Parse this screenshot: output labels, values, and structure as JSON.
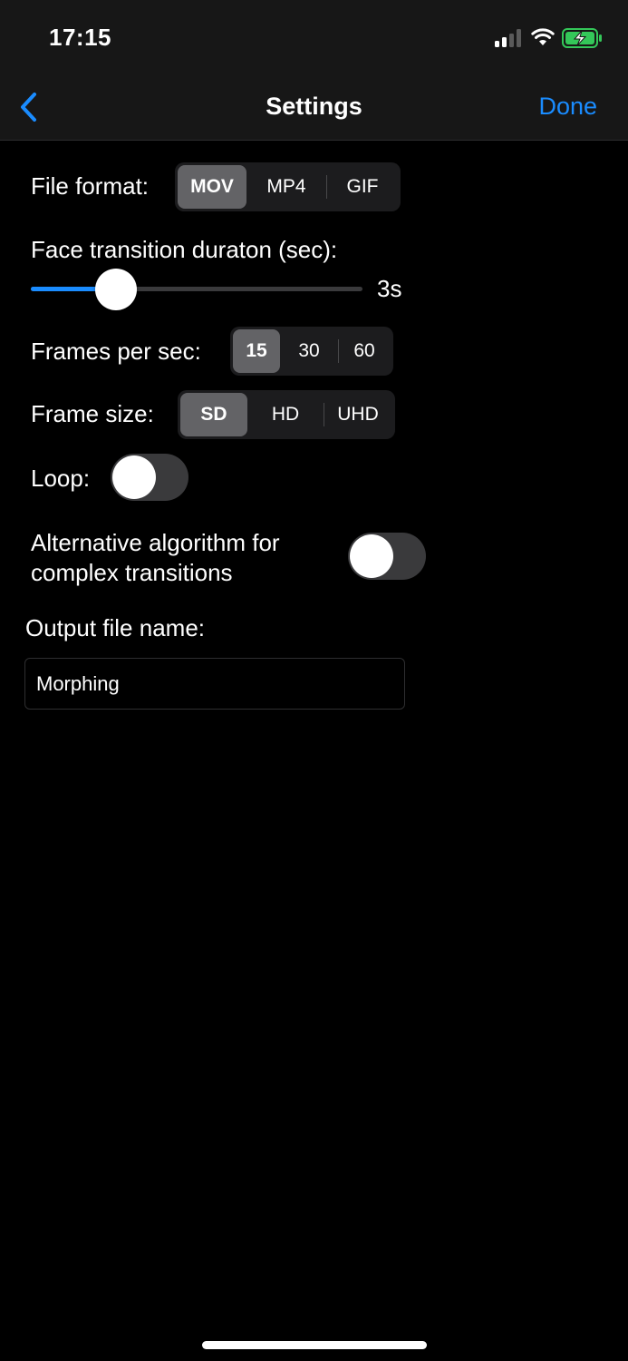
{
  "status_bar": {
    "time": "17:15",
    "battery_color": "#34c759"
  },
  "nav": {
    "back_icon": "chevron-left-icon",
    "title": "Settings",
    "done_label": "Done",
    "accent_color": "#1a8cff"
  },
  "settings": {
    "file_format": {
      "label": "File format:",
      "options": [
        "MOV",
        "MP4",
        "GIF"
      ],
      "selected": "MOV"
    },
    "face_transition": {
      "label": "Face transition duraton (sec):",
      "value_label": "3s",
      "fill_fraction": 0.25
    },
    "frames_per_sec": {
      "label": "Frames per sec:",
      "options": [
        "15",
        "30",
        "60"
      ],
      "selected": "15"
    },
    "frame_size": {
      "label": "Frame size:",
      "options": [
        "SD",
        "HD",
        "UHD"
      ],
      "selected": "SD"
    },
    "loop": {
      "label": "Loop:",
      "on": false
    },
    "alt_algorithm": {
      "label_line1": "Alternative algorithm for",
      "label_line2": "complex transitions",
      "on": false
    },
    "output_file": {
      "label": "Output file name:",
      "value": "Morphing"
    }
  }
}
